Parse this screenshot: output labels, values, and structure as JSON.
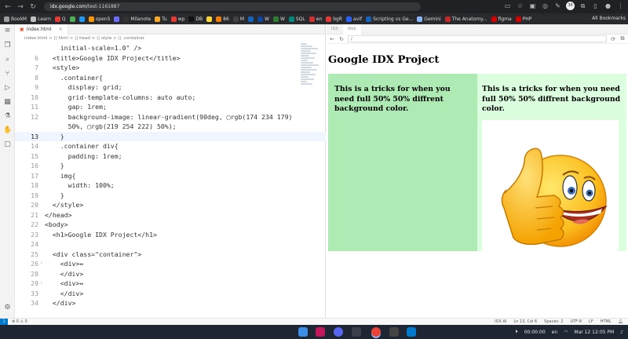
{
  "browser": {
    "address_host": "idx.google.com",
    "address_path": "/test-1161887",
    "profile_label": "36",
    "bookmarks": [
      {
        "label": "BookM",
        "color": "#9e9e9e"
      },
      {
        "label": "Learn",
        "color": "#c0c0c0"
      },
      {
        "label": "Q",
        "color": "#e53935"
      },
      {
        "label": "",
        "color": "#4caf50"
      },
      {
        "label": "",
        "color": "#2196f3"
      },
      {
        "label": "openS",
        "color": "#ff9800"
      },
      {
        "label": "",
        "color": "#6c6cff"
      },
      {
        "label": "Milanote",
        "color": "#333333"
      },
      {
        "label": "Tu",
        "color": "#f9a825"
      },
      {
        "label": "wp",
        "color": "#e53935"
      },
      {
        "label": "DB",
        "color": "#111111"
      },
      {
        "label": "",
        "color": "#fdd835"
      },
      {
        "label": "86",
        "color": "#f57c00"
      },
      {
        "label": "M",
        "color": "#424242"
      },
      {
        "label": "",
        "color": "#1565c0"
      },
      {
        "label": "W",
        "color": "#0d47a1"
      },
      {
        "label": "W",
        "color": "#2e7d32"
      },
      {
        "label": "SQL",
        "color": "#00897b"
      },
      {
        "label": "en",
        "color": "#d32f2f"
      },
      {
        "label": "bgR",
        "color": "#e53935"
      },
      {
        "label": "avif",
        "color": "#2962ff"
      },
      {
        "label": "Scripting vs Ge...",
        "color": "#1565c0"
      },
      {
        "label": "Gemini",
        "color": "#8ab4f8"
      },
      {
        "label": "The Anatomy...",
        "color": "#c62828"
      },
      {
        "label": "figma",
        "color": "#d50000"
      },
      {
        "label": "PHP",
        "color": "#d50000"
      }
    ],
    "all_bookmarks": "All Bookmarks"
  },
  "editor": {
    "tab_name": "index.html",
    "breadcrumb": "index.html > ⟨⟩ html > ⟨⟩ head > ⟨⟩ style > ⟨⟩ .container",
    "lines": [
      {
        "n": "",
        "t": "    initial-scale=1.0\" />"
      },
      {
        "n": "6",
        "t": "  <title>Google IDX Project</title>"
      },
      {
        "n": "7",
        "t": "  <style>"
      },
      {
        "n": "8",
        "t": "    .container{"
      },
      {
        "n": "9",
        "t": "      display: grid;"
      },
      {
        "n": "10",
        "t": "      grid-template-columns: auto auto;"
      },
      {
        "n": "11",
        "t": "      gap: 1rem;"
      },
      {
        "n": "12",
        "t": "      background-image: linear-gradient(90deg, ▢rgb(174 234 179)"
      },
      {
        "n": "",
        "t": "      50%, ▢rgb(219 254 222) 50%);"
      },
      {
        "n": "13",
        "t": "    }",
        "cur": true
      },
      {
        "n": "14",
        "t": "    .container div{"
      },
      {
        "n": "15",
        "t": "      padding: 1rem;"
      },
      {
        "n": "16",
        "t": "    }"
      },
      {
        "n": "17",
        "t": "    img{"
      },
      {
        "n": "18",
        "t": "      width: 100%;"
      },
      {
        "n": "19",
        "t": "    }"
      },
      {
        "n": "20",
        "t": "  </style>"
      },
      {
        "n": "21",
        "t": "</head>"
      },
      {
        "n": "22",
        "t": "<body>"
      },
      {
        "n": "23",
        "t": "  <h1>Google IDX Project</h1>"
      },
      {
        "n": "24",
        "t": ""
      },
      {
        "n": "25",
        "t": "  <div class=\"container\">"
      },
      {
        "n": "26",
        "t": "    <div>↔",
        "fold": true
      },
      {
        "n": "28",
        "t": "    </div>"
      },
      {
        "n": "29",
        "t": "    <div>↔",
        "fold": true
      },
      {
        "n": "33",
        "t": "    </div>"
      },
      {
        "n": "34",
        "t": "  </div>"
      }
    ]
  },
  "preview": {
    "tab_idx": "IDX",
    "tab_web": "Web",
    "url": "/",
    "h1": "Google IDX Project",
    "cell1": "This is a tricks for when you need full 50% 50% diffrent background color.",
    "cell2": "This is a tricks for when you need full 50% 50% diffrent background color."
  },
  "statusbar": {
    "errors": "⊗ 0  ⚠ 0",
    "idx_ai": "IDX AI",
    "position": "Ln 13, Col 6",
    "spaces": "Spaces: 2",
    "encoding": "UTF-8",
    "eol": "LF",
    "language": "HTML"
  },
  "taskbar": {
    "media_time": "00:00:00",
    "lang": "en",
    "date_time": "Mar 12  12:05 PM"
  },
  "colors": {
    "left_bg": "#aeeab3",
    "right_bg": "#dbfede",
    "accent": "#007acc"
  }
}
